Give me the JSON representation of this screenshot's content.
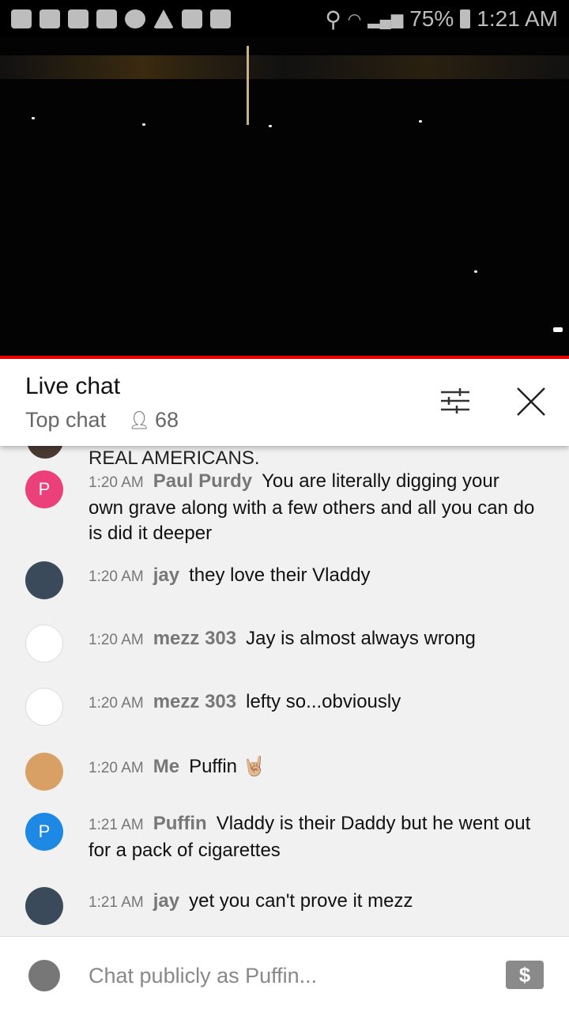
{
  "status_bar": {
    "battery": "75%",
    "time": "1:21 AM"
  },
  "chat": {
    "title": "Live chat",
    "mode": "Top chat",
    "viewers": "68",
    "partial_message": "REAL AMERICANS.",
    "messages": [
      {
        "time": "1:20 AM",
        "author": "Paul Purdy",
        "text": "You are literally digging your own grave along with a few others and all you can do is did it deeper",
        "avatar": "P",
        "avatar_color": "#ec407a"
      },
      {
        "time": "1:20 AM",
        "author": "jay",
        "text": "they love their Vladdy",
        "avatar": "",
        "avatar_color": "#3a4a5a"
      },
      {
        "time": "1:20 AM",
        "author": "mezz 303",
        "text": "Jay is almost always wrong",
        "avatar": "",
        "avatar_color": "#ffffff"
      },
      {
        "time": "1:20 AM",
        "author": "mezz 303",
        "text": "lefty so...obviously",
        "avatar": "",
        "avatar_color": "#ffffff"
      },
      {
        "time": "1:20 AM",
        "author": "Me",
        "text": "Puffin 🤘🏼",
        "avatar": "",
        "avatar_color": "#d9a066"
      },
      {
        "time": "1:21 AM",
        "author": "Puffin",
        "text": "Vladdy is their Daddy but he went out for a pack of cigarettes",
        "avatar": "P",
        "avatar_color": "#1e88e5"
      },
      {
        "time": "1:21 AM",
        "author": "jay",
        "text": "yet you can't prove it mezz",
        "avatar": "",
        "avatar_color": "#3a4a5a"
      }
    ]
  },
  "input": {
    "placeholder": "Chat publicly as Puffin...",
    "super_chat_icon": "$"
  }
}
